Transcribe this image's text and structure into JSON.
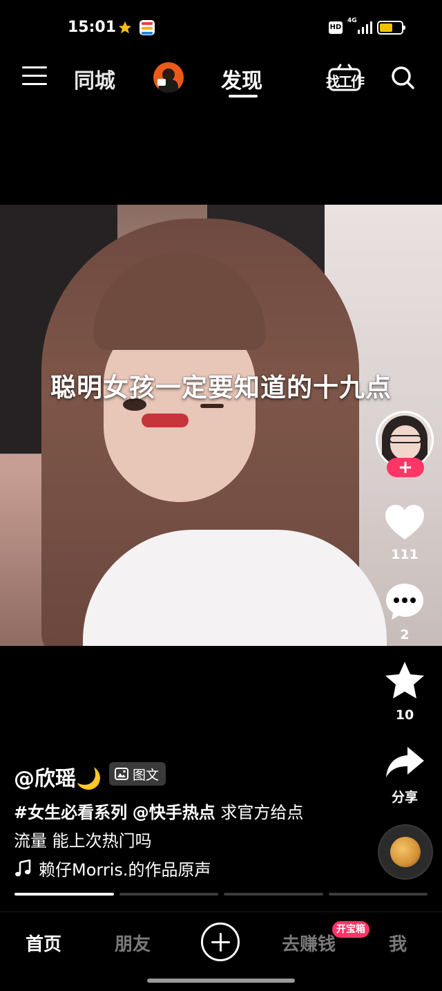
{
  "status_bar": {
    "time": "15:01",
    "hd_label": "HD",
    "network": "4G",
    "icons": [
      "star-icon",
      "app-notification-icon",
      "hd-icon",
      "signal-icon",
      "battery-icon"
    ],
    "battery_color": "#f2c200"
  },
  "top_nav": {
    "tongcheng": "同城",
    "faxian": "发现",
    "job_label": "找工作",
    "active_tab": "发现"
  },
  "video": {
    "caption": "聪明女孩一定要知道的十九点"
  },
  "actions": {
    "follow_label": "+",
    "like_count": "111",
    "comment_count": "2",
    "favorite_count": "10",
    "share_label": "分享"
  },
  "post": {
    "author": "@欣瑶🌙",
    "badge": "图文",
    "tag1": "#女生必看系列",
    "tag2": "@快手热点",
    "caption_line1_rest": " 求官方给点",
    "caption_line2": "流量 能上次热门吗",
    "music": "赖仔Morris.的作品原声",
    "progress": {
      "active_index": 0,
      "segments": 4
    }
  },
  "bottom_nav": {
    "home": "首页",
    "friends": "朋友",
    "earn": "去赚钱",
    "earn_badge": "开宝箱",
    "me": "我",
    "active_tab": "首页"
  },
  "colors": {
    "accent": "#fe3666",
    "background": "#000000"
  }
}
